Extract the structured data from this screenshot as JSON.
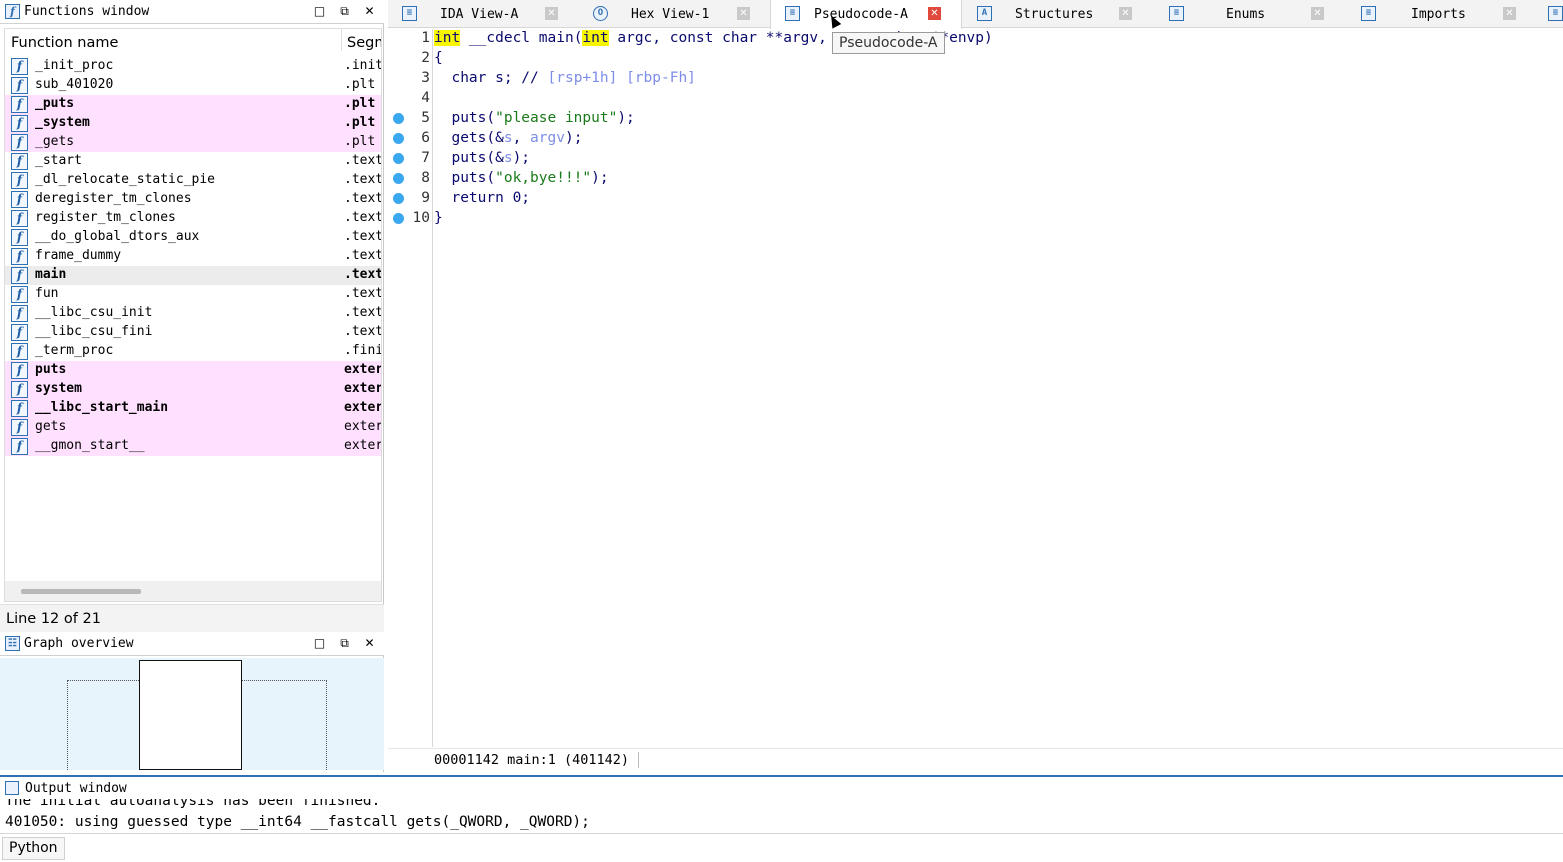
{
  "functions_window": {
    "title": "Functions window",
    "col_name": "Function name",
    "col_segment": "Segm",
    "rows": [
      {
        "name": "_init_proc",
        "seg": ".init",
        "style": "normal"
      },
      {
        "name": "sub_401020",
        "seg": ".plt",
        "style": "normal"
      },
      {
        "name": "_puts",
        "seg": ".plt",
        "style": "pink-bold"
      },
      {
        "name": "_system",
        "seg": ".plt",
        "style": "pink-bold"
      },
      {
        "name": "_gets",
        "seg": ".plt",
        "style": "pink"
      },
      {
        "name": "_start",
        "seg": ".text",
        "style": "normal"
      },
      {
        "name": "_dl_relocate_static_pie",
        "seg": ".text",
        "style": "normal"
      },
      {
        "name": "deregister_tm_clones",
        "seg": ".text",
        "style": "normal"
      },
      {
        "name": "register_tm_clones",
        "seg": ".text",
        "style": "normal"
      },
      {
        "name": "__do_global_dtors_aux",
        "seg": ".text",
        "style": "normal"
      },
      {
        "name": "frame_dummy",
        "seg": ".text",
        "style": "normal"
      },
      {
        "name": "main",
        "seg": ".text",
        "style": "selected-bold"
      },
      {
        "name": "fun",
        "seg": ".text",
        "style": "normal"
      },
      {
        "name": "__libc_csu_init",
        "seg": ".text",
        "style": "normal"
      },
      {
        "name": "__libc_csu_fini",
        "seg": ".text",
        "style": "normal"
      },
      {
        "name": "_term_proc",
        "seg": ".fini",
        "style": "normal"
      },
      {
        "name": "puts",
        "seg": "extern",
        "style": "pink-bold"
      },
      {
        "name": "system",
        "seg": "extern",
        "style": "pink-bold"
      },
      {
        "name": "__libc_start_main",
        "seg": "extern",
        "style": "pink-bold"
      },
      {
        "name": "gets",
        "seg": "extern",
        "style": "pink"
      },
      {
        "name": "__gmon_start__",
        "seg": "extern",
        "style": "pink"
      }
    ],
    "status": "Line 12 of 21"
  },
  "graph_overview": {
    "title": "Graph overview"
  },
  "tabs": [
    {
      "label": "IDA View-A",
      "icon": "listing-icon",
      "active": false
    },
    {
      "label": "Hex View-1",
      "icon": "hex-icon",
      "active": false
    },
    {
      "label": "Pseudocode-A",
      "icon": "pseudocode-icon",
      "active": true
    },
    {
      "label": "Structures",
      "icon": "structures-icon",
      "active": false
    },
    {
      "label": "Enums",
      "icon": "enums-icon",
      "active": false
    },
    {
      "label": "Imports",
      "icon": "imports-icon",
      "active": false
    }
  ],
  "tooltip": "Pseudocode-A",
  "code": {
    "line1": {
      "n": "1",
      "kw1": "int",
      "t1": " __cdecl main(",
      "kw2": "int",
      "t2": " argc, const char **argv, const char **envp)"
    },
    "line2": {
      "n": "2",
      "t": "{"
    },
    "line3": {
      "n": "3",
      "t": "  char s; // ",
      "c": "[rsp+1h] [rbp-Fh]"
    },
    "line4": {
      "n": "4"
    },
    "line5": {
      "n": "5",
      "t1": "  puts(",
      "s": "\"please input\"",
      "t2": ");"
    },
    "line6": {
      "n": "6",
      "t1": "  gets(&",
      "v1": "s",
      "t2": ", ",
      "v2": "argv",
      "t3": ");"
    },
    "line7": {
      "n": "7",
      "t1": "  puts(&",
      "v1": "s",
      "t2": ");"
    },
    "line8": {
      "n": "8",
      "t1": "  puts(",
      "s": "\"ok,bye!!!\"",
      "t2": ");"
    },
    "line9": {
      "n": "9",
      "t": "  return 0;"
    },
    "line10": {
      "n": "10",
      "t": "}"
    }
  },
  "code_status": "00001142 main:1 (401142)",
  "output_window": {
    "title": "Output window",
    "lines": [
      "The initial autoanalysis has been finished.",
      "401050: using guessed type __int64 __fastcall gets(_QWORD, _QWORD);"
    ]
  },
  "command_bar": {
    "language": "Python"
  }
}
